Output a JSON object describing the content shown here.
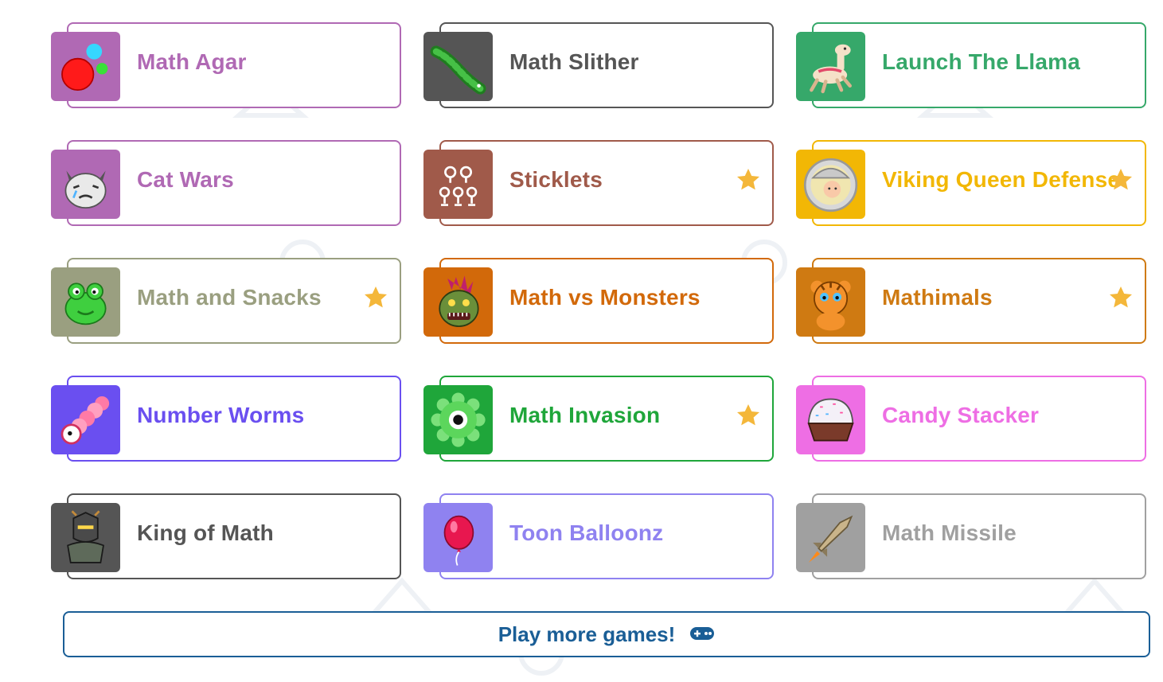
{
  "games": [
    {
      "title": "Math Agar",
      "color": "#b069b4",
      "icon": "agar-cells-icon",
      "starred": false
    },
    {
      "title": "Math Slither",
      "color": "#555555",
      "icon": "slither-snake-icon",
      "starred": false
    },
    {
      "title": "Launch The Llama",
      "color": "#36a86a",
      "icon": "llama-icon",
      "starred": false
    },
    {
      "title": "Cat Wars",
      "color": "#b069b4",
      "icon": "cat-face-icon",
      "starred": false
    },
    {
      "title": "Sticklets",
      "color": "#a05a4a",
      "icon": "sticklets-icon",
      "starred": true
    },
    {
      "title": "Viking Queen Defense",
      "color": "#f2b705",
      "icon": "viking-queen-icon",
      "starred": true
    },
    {
      "title": "Math and Snacks",
      "color": "#9a9f80",
      "icon": "frog-icon",
      "starred": true
    },
    {
      "title": "Math vs Monsters",
      "color": "#d2690a",
      "icon": "monster-icon",
      "starred": false
    },
    {
      "title": "Mathimals",
      "color": "#cf7a12",
      "icon": "tiger-cub-icon",
      "starred": true
    },
    {
      "title": "Number Worms",
      "color": "#6a4ff0",
      "icon": "worm-icon",
      "starred": false
    },
    {
      "title": "Math Invasion",
      "color": "#1fa63a",
      "icon": "green-eye-icon",
      "starred": true
    },
    {
      "title": "Candy Stacker",
      "color": "#ee6ee4",
      "icon": "cupcake-icon",
      "starred": false
    },
    {
      "title": "King of Math",
      "color": "#555555",
      "icon": "knight-icon",
      "starred": false
    },
    {
      "title": "Toon Balloonz",
      "color": "#8f82f0",
      "icon": "balloon-icon",
      "starred": false
    },
    {
      "title": "Math Missile",
      "color": "#a0a0a0",
      "icon": "rocket-icon",
      "starred": false
    }
  ],
  "star_color": "#f4b73a",
  "play_more": {
    "label": "Play more games!",
    "icon": "gamepad-icon",
    "color": "#1a5e96"
  }
}
